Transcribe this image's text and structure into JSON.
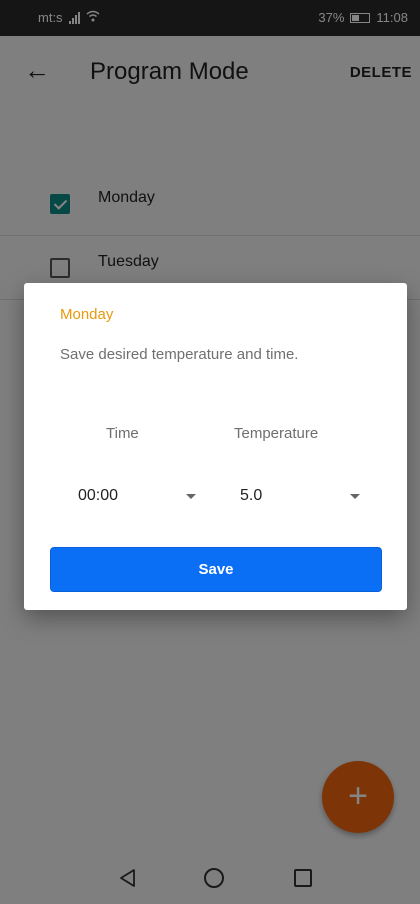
{
  "status_bar": {
    "carrier": "mt:s",
    "battery": "37%",
    "time": "11:08"
  },
  "app_bar": {
    "title": "Program Mode",
    "delete_label": "DELETE"
  },
  "days": [
    {
      "label": "Monday",
      "checked": true
    },
    {
      "label": "Tuesday",
      "checked": false
    }
  ],
  "dialog": {
    "title": "Monday",
    "message": "Save desired temperature and time.",
    "time_label": "Time",
    "temperature_label": "Temperature",
    "time_value": "00:00",
    "temperature_value": "5.0",
    "save_label": "Save"
  },
  "fab": {
    "icon": "plus-icon"
  },
  "colors": {
    "fab": "#f0650e",
    "checkbox": "#0d8a86",
    "dialog_title": "#e69a0c",
    "save_button": "#0a6ff5"
  }
}
